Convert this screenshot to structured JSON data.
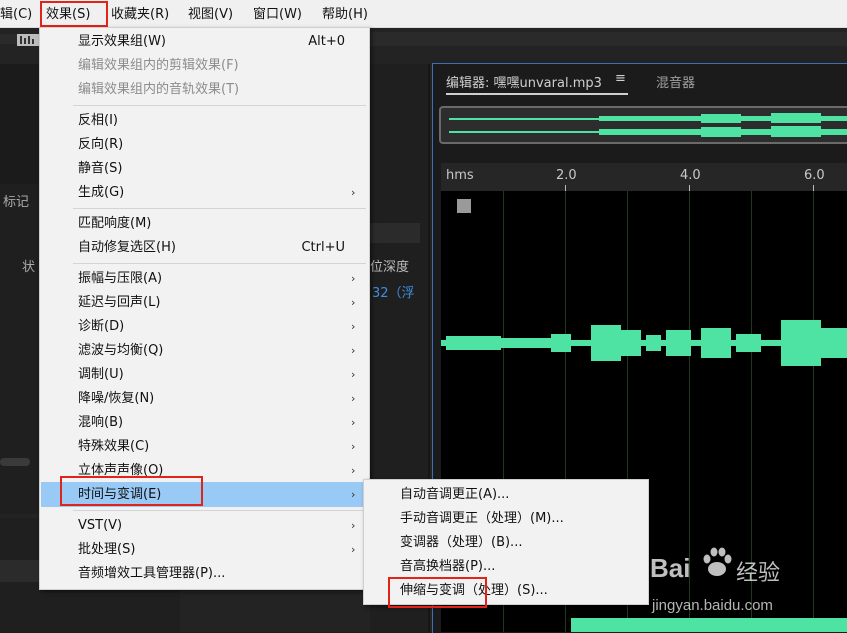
{
  "menubar": {
    "items": [
      "辑(C)",
      "效果(S)",
      "收藏夹(R)",
      "视图(V)",
      "窗口(W)",
      "帮助(H)"
    ]
  },
  "background_panels": {
    "marker_label": "标记",
    "status_label": "状",
    "bit_depth_label": "位深度",
    "bit_depth_value": "32（浮"
  },
  "editor": {
    "tab_label": "编辑器: 嘿嘿unvaral.mp3",
    "menu_icon": "hamburger-icon",
    "mixer_tab": "混音器",
    "timeline": {
      "unit": "hms",
      "ticks": [
        "2.0",
        "4.0",
        "6.0"
      ]
    },
    "waveform_color": "#4fe3a3"
  },
  "effects_menu": {
    "items": [
      {
        "label": "显示效果组(W)",
        "shortcut": "Alt+0"
      },
      {
        "label": "编辑效果组内的剪辑效果(F)",
        "disabled": true
      },
      {
        "label": "编辑效果组内的音轨效果(T)",
        "disabled": true
      },
      {
        "label": "反相(I)"
      },
      {
        "label": "反向(R)"
      },
      {
        "label": "静音(S)"
      },
      {
        "label": "生成(G)",
        "submenu": true
      },
      {
        "label": "匹配响度(M)"
      },
      {
        "label": "自动修复选区(H)",
        "shortcut": "Ctrl+U"
      },
      {
        "label": "振幅与压限(A)",
        "submenu": true
      },
      {
        "label": "延迟与回声(L)",
        "submenu": true
      },
      {
        "label": "诊断(D)",
        "submenu": true
      },
      {
        "label": "滤波与均衡(Q)",
        "submenu": true
      },
      {
        "label": "调制(U)",
        "submenu": true
      },
      {
        "label": "降噪/恢复(N)",
        "submenu": true
      },
      {
        "label": "混响(B)",
        "submenu": true
      },
      {
        "label": "特殊效果(C)",
        "submenu": true
      },
      {
        "label": "立体声声像(O)",
        "submenu": true
      },
      {
        "label": "时间与变调(E)",
        "submenu": true,
        "highlighted": true
      },
      {
        "label": "VST(V)",
        "submenu": true
      },
      {
        "label": "批处理(S)",
        "submenu": true
      },
      {
        "label": "音频增效工具管理器(P)..."
      }
    ]
  },
  "time_pitch_submenu": {
    "items": [
      "自动音调更正(A)...",
      "手动音调更正（处理）(M)...",
      "变调器（处理）(B)...",
      "音高换档器(P)...",
      "伸缩与变调（处理）(S)..."
    ]
  },
  "watermark": {
    "brand": "Bai",
    "brand_suffix": "经验",
    "url": "jingyan.baidu.com"
  },
  "colors": {
    "highlight": "#99c9f5",
    "annotation": "#e2231a",
    "accent_border": "#3b6fb6"
  }
}
